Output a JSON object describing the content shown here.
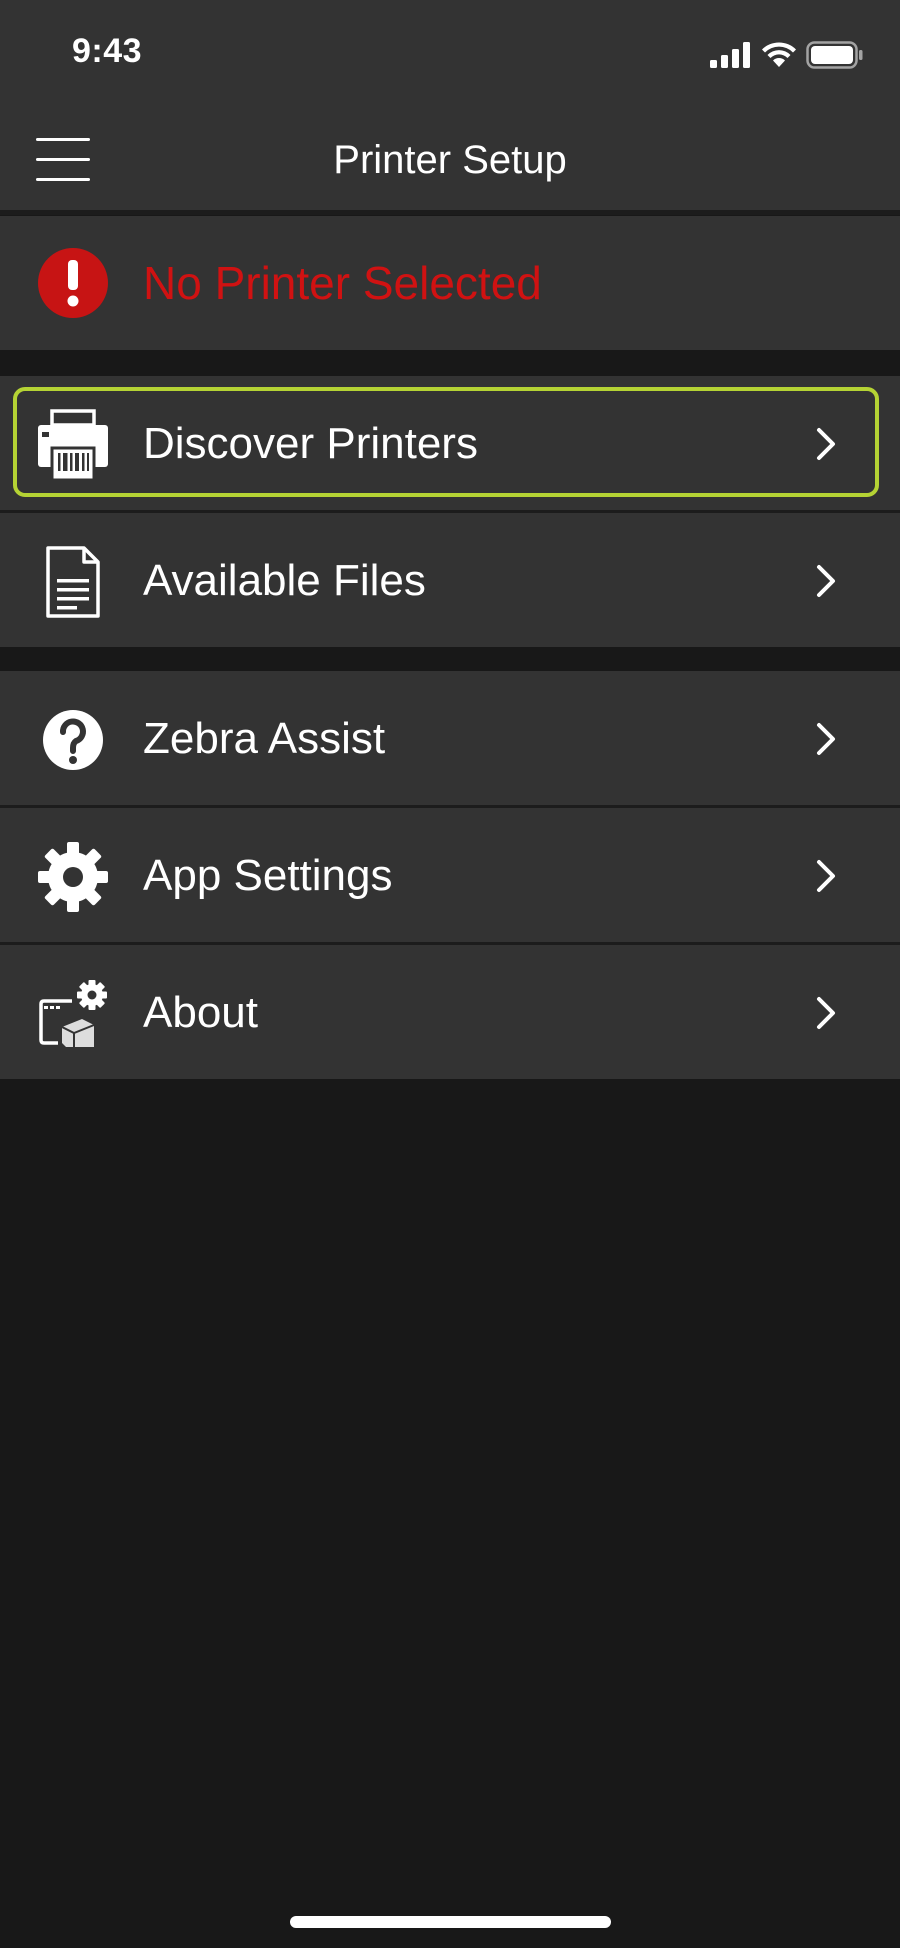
{
  "status_bar": {
    "time": "9:43",
    "icons": [
      "signal-icon",
      "wifi-icon",
      "battery-icon"
    ]
  },
  "nav": {
    "title": "Printer Setup",
    "menu_icon": "hamburger-menu-icon"
  },
  "printer_status": {
    "text": "No Printer Selected",
    "icon": "alert-icon",
    "color": "#d01212"
  },
  "menu": {
    "items": [
      {
        "label": "Discover Printers",
        "icon": "printer-icon",
        "focused": true
      },
      {
        "label": "Available Files",
        "icon": "file-icon",
        "focused": false
      },
      {
        "label": "Zebra Assist",
        "icon": "help-icon",
        "focused": false
      },
      {
        "label": "App Settings",
        "icon": "gear-icon",
        "focused": false
      },
      {
        "label": "About",
        "icon": "about-icon",
        "focused": false
      }
    ]
  },
  "colors": {
    "background": "#181818",
    "row": "#333333",
    "focus": "#b5d334",
    "text": "#ffffff"
  }
}
